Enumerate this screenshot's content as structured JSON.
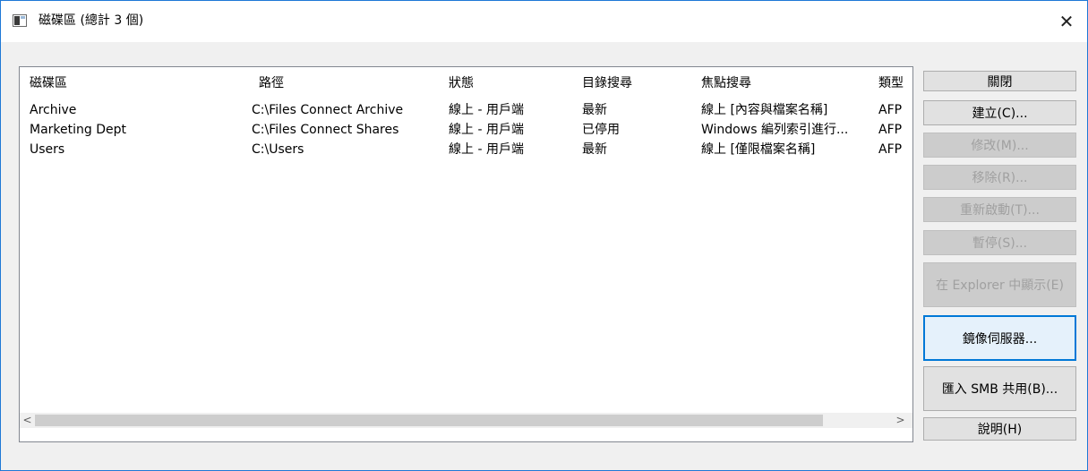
{
  "window": {
    "title": "磁碟區 (總計 3 個)"
  },
  "columns": [
    "磁碟區",
    "路徑",
    "狀態",
    "目錄搜尋",
    "焦點搜尋",
    "類型"
  ],
  "rows": [
    [
      "Archive",
      "C:\\Files Connect Archive",
      "線上 - 用戶端",
      "最新",
      "線上 [內容與檔案名稱]",
      "AFP"
    ],
    [
      "Marketing Dept",
      "C:\\Files Connect Shares",
      "線上 - 用戶端",
      "已停用",
      "Windows 編列索引進行...",
      "AFP"
    ],
    [
      "Users",
      "C:\\Users",
      "線上 - 用戶端",
      "最新",
      "線上 [僅限檔案名稱]",
      "AFP"
    ]
  ],
  "buttons": {
    "close": "關閉",
    "create": "建立(C)...",
    "modify": "修改(M)...",
    "remove": "移除(R)...",
    "restart": "重新啟動(T)...",
    "pause": "暫停(S)...",
    "show_in_explorer": "在 Explorer 中顯示(E)",
    "mirror_servers": "鏡像伺服器...",
    "import_smb": "匯入 SMB 共用(B)...",
    "help": "說明(H)"
  },
  "icons": {
    "window_icon": "app-window-icon",
    "close": "close-icon",
    "scroll_left": "chevron-left-icon",
    "scroll_right": "chevron-right-icon"
  }
}
